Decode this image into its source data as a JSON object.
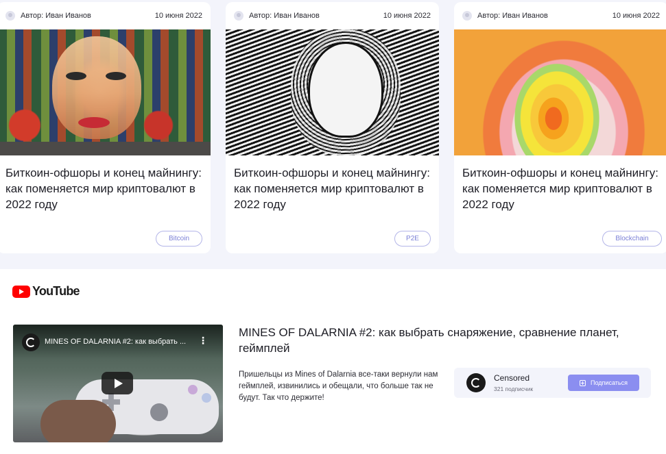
{
  "articles": [
    {
      "author": "Автор: Иван Иванов",
      "date": "10 июня 2022",
      "title": "Биткоин-офшоры и конец майнингу: как поменяется мир криптовалют в 2022 году",
      "tag": "Bitcoin",
      "image": "mosaic-street-art-portrait"
    },
    {
      "author": "Автор: Иван Иванов",
      "date": "10 июня 2022",
      "title": "Биткоин-офшоры и конец майнингу: как поменяется мир криптовалют в 2022 году",
      "tag": "P2E",
      "image": "black-white-engraving-portrait"
    },
    {
      "author": "Автор: Иван Иванов",
      "date": "10 июня 2022",
      "title": "Биткоин-офшоры и конец майнингу: как поменяется мир криптовалют в 2022 году",
      "tag": "Blockchain",
      "image": "concentric-color-layers"
    }
  ],
  "youtube": {
    "logo_text": "YouTube",
    "video": {
      "overlay_title": "MINES OF DALARNIA #2: как выбрать ...",
      "menu_icon": "more-vert-icon",
      "play_icon": "play-icon"
    },
    "title": "MINES OF DALARNIA #2: как выбрать снаряжение, сравнение планет, геймплей",
    "description": "Пришельцы из Mines of Dalarnia все-таки вернули нам геймплей, извинились и обещали, что больше так не будут. Так что держите!",
    "channel": {
      "name": "Censored",
      "subscribers": "321 подписчик",
      "subscribe_label": "Подписаться"
    }
  },
  "colors": {
    "page_bg": "#f3f4fb",
    "tag_border": "#b3b5e8",
    "tag_text": "#7a7fd6",
    "subscribe_bg": "#8b8ef0",
    "youtube_red": "#ff0000"
  }
}
